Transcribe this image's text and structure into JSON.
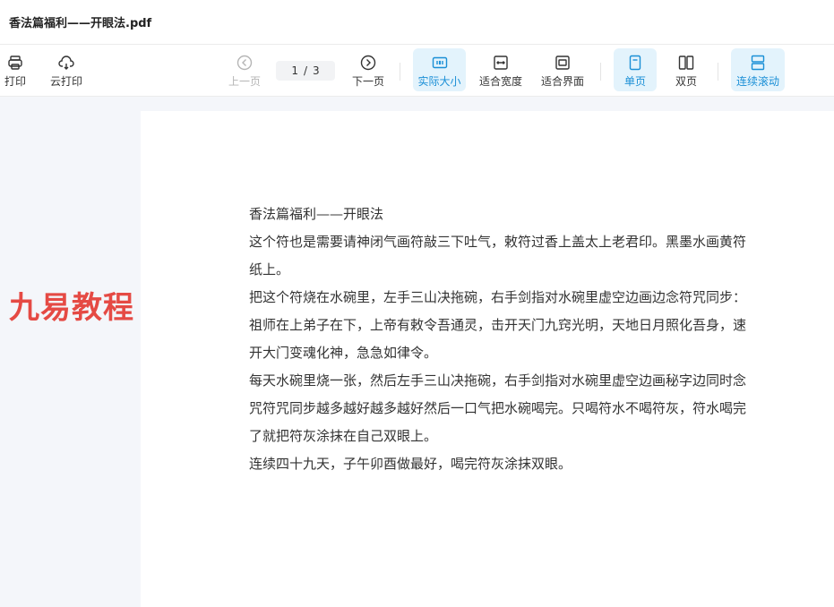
{
  "window": {
    "title": "香法篇福利——开眼法.pdf"
  },
  "toolbar": {
    "print_label": "打印",
    "cloud_print_label": "云打印",
    "prev_label": "上一页",
    "current_page": "1",
    "page_sep": "/",
    "total_pages": "3",
    "next_label": "下一页",
    "actual_size_label": "实际大小",
    "fit_width_label": "适合宽度",
    "fit_screen_label": "适合界面",
    "single_page_label": "单页",
    "double_page_label": "双页",
    "continuous_label": "连续滚动"
  },
  "watermark": {
    "text": "九易教程"
  },
  "document": {
    "paragraphs": [
      "香法篇福利——开眼法",
      "这个符也是需要请神闭气画符敲三下吐气，敕符过香上盖太上老君印。黑墨水画黄符纸上。",
      "把这个符烧在水碗里，左手三山决拖碗，右手剑指对水碗里虚空边画边念符咒同步：祖师在上弟子在下，上帝有敕令吾通灵，击开天门九窍光明，天地日月照化吾身，速开大门变魂化神，急急如律令。",
      "每天水碗里烧一张，然后左手三山决拖碗，右手剑指对水碗里虚空边画秘字边同时念咒符咒同步越多越好越多越好然后一口气把水碗喝完。只喝符水不喝符灰，符水喝完了就把符灰涂抹在自己双眼上。",
      "连续四十九天，子午卯酉做最好，喝完符灰涂抹双眼。"
    ]
  },
  "icons": {
    "print": "printer-icon",
    "cloud_print": "cloud-icon",
    "prev": "circle-left-arrow-icon",
    "next": "circle-right-arrow-icon",
    "actual_size": "one-to-one-icon",
    "fit_width": "fit-width-icon",
    "fit_screen": "fit-screen-icon",
    "single_page": "single-page-icon",
    "double_page": "double-page-icon",
    "continuous": "continuous-scroll-icon"
  },
  "colors": {
    "accent": "#1a8fd6",
    "active_bg": "#e3f3fc",
    "watermark": "#e54a44"
  }
}
